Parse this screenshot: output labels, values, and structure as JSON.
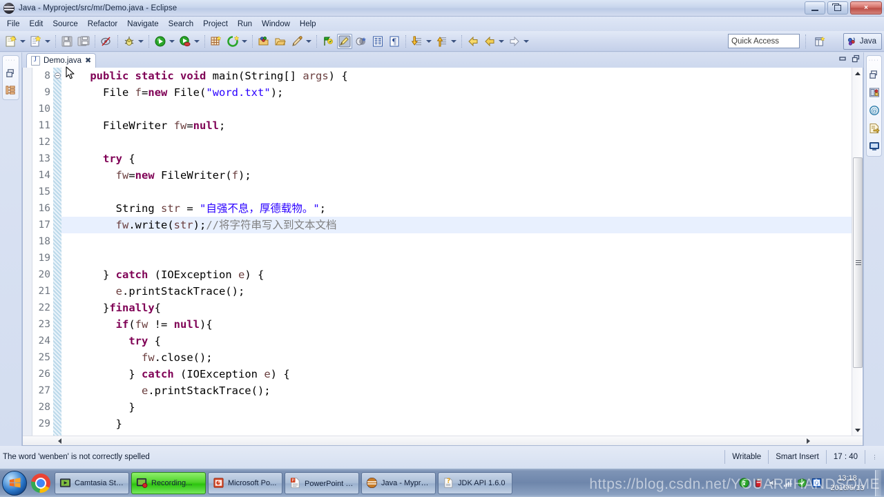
{
  "window": {
    "title": "Java - Myproject/src/mr/Demo.java - Eclipse",
    "icon": "eclipse-icon",
    "minimize_label": "Minimize",
    "maximize_label": "Restore",
    "close_label": "×"
  },
  "menubar": {
    "items": [
      {
        "label": "File"
      },
      {
        "label": "Edit"
      },
      {
        "label": "Source"
      },
      {
        "label": "Refactor"
      },
      {
        "label": "Navigate"
      },
      {
        "label": "Search"
      },
      {
        "label": "Project"
      },
      {
        "label": "Run"
      },
      {
        "label": "Window"
      },
      {
        "label": "Help"
      }
    ]
  },
  "toolbar": {
    "quick_access_placeholder": "Quick Access",
    "perspective_label": "Java",
    "open_perspective_icon": "open-perspective-icon",
    "buttons": [
      {
        "name": "new-wizard-icon",
        "has_dropdown": true
      },
      {
        "name": "new-java-class-icon",
        "has_dropdown": true
      },
      {
        "name": "save-icon",
        "has_dropdown": false
      },
      {
        "name": "save-all-icon",
        "has_dropdown": false
      },
      {
        "name": "toggle-breakpoint-skip-icon",
        "has_dropdown": false
      },
      {
        "name": "debug-icon",
        "has_dropdown": true
      },
      {
        "name": "run-icon",
        "has_dropdown": true
      },
      {
        "name": "run-coverage-icon",
        "has_dropdown": true
      },
      {
        "name": "new-java-project-icon",
        "has_dropdown": false
      },
      {
        "name": "external-tools-icon",
        "has_dropdown": true
      },
      {
        "name": "open-type-icon",
        "has_dropdown": false
      },
      {
        "name": "open-task-icon",
        "has_dropdown": false
      },
      {
        "name": "search-pencil-icon",
        "has_dropdown": true
      },
      {
        "name": "last-edit-location-icon",
        "has_dropdown": false
      },
      {
        "name": "toggle-mark-occurrences-icon",
        "has_dropdown": false,
        "pressed": true
      },
      {
        "name": "link-with-editor-icon",
        "has_dropdown": false
      },
      {
        "name": "show-whitespace-icon",
        "has_dropdown": false
      },
      {
        "name": "pilcrow-icon",
        "has_dropdown": false
      },
      {
        "name": "next-annotation-icon",
        "has_dropdown": true
      },
      {
        "name": "previous-annotation-icon",
        "has_dropdown": true
      },
      {
        "name": "back-icon",
        "has_dropdown": false
      },
      {
        "name": "forward-icon",
        "has_dropdown": true
      }
    ]
  },
  "left_rail": {
    "items": [
      {
        "name": "restore-view-icon",
        "label": "Restore"
      },
      {
        "name": "package-explorer-icon",
        "label": "Package Explorer"
      }
    ]
  },
  "right_rail": {
    "items": [
      {
        "name": "restore-view-icon",
        "label": "Restore"
      },
      {
        "name": "outline-view-icon",
        "label": "Outline"
      },
      {
        "name": "javadoc-view-icon",
        "label": "Javadoc"
      },
      {
        "name": "declaration-view-icon",
        "label": "Declaration"
      },
      {
        "name": "console-view-icon",
        "label": "Console"
      }
    ]
  },
  "editor": {
    "tab": {
      "label": "Demo.java",
      "icon": "java-file-icon",
      "close": "✖"
    },
    "minimize_label": "Minimize",
    "maximize_label": "Maximize",
    "highlighted_line": 17,
    "first_visible_line": 8,
    "lines": [
      {
        "n": 8,
        "folding": true,
        "indent": 4,
        "tokens": [
          {
            "t": "public ",
            "c": "kw"
          },
          {
            "t": "static ",
            "c": "kw"
          },
          {
            "t": "void ",
            "c": "kw"
          },
          {
            "t": "main",
            "c": "mth"
          },
          {
            "t": "(",
            "c": "typ"
          },
          {
            "t": "String",
            "c": "typ"
          },
          {
            "t": "[] ",
            "c": "typ"
          },
          {
            "t": "args",
            "c": "loc"
          },
          {
            "t": ") {",
            "c": "typ"
          }
        ]
      },
      {
        "n": 9,
        "folding": false,
        "indent": 6,
        "tokens": [
          {
            "t": "File ",
            "c": "typ"
          },
          {
            "t": "f",
            "c": "loc"
          },
          {
            "t": "=",
            "c": "typ"
          },
          {
            "t": "new ",
            "c": "kw"
          },
          {
            "t": "File(",
            "c": "typ"
          },
          {
            "t": "\"word.txt\"",
            "c": "str"
          },
          {
            "t": ");",
            "c": "typ"
          }
        ]
      },
      {
        "n": 10,
        "folding": false,
        "indent": 0,
        "tokens": []
      },
      {
        "n": 11,
        "folding": false,
        "indent": 6,
        "tokens": [
          {
            "t": "FileWriter ",
            "c": "typ"
          },
          {
            "t": "fw",
            "c": "loc"
          },
          {
            "t": "=",
            "c": "typ"
          },
          {
            "t": "null",
            "c": "kw"
          },
          {
            "t": ";",
            "c": "typ"
          }
        ]
      },
      {
        "n": 12,
        "folding": false,
        "indent": 0,
        "tokens": []
      },
      {
        "n": 13,
        "folding": false,
        "indent": 6,
        "tokens": [
          {
            "t": "try",
            "c": "kw"
          },
          {
            "t": " {",
            "c": "typ"
          }
        ]
      },
      {
        "n": 14,
        "folding": false,
        "indent": 8,
        "tokens": [
          {
            "t": "fw",
            "c": "loc"
          },
          {
            "t": "=",
            "c": "typ"
          },
          {
            "t": "new ",
            "c": "kw"
          },
          {
            "t": "FileWriter(",
            "c": "typ"
          },
          {
            "t": "f",
            "c": "loc"
          },
          {
            "t": ");",
            "c": "typ"
          }
        ]
      },
      {
        "n": 15,
        "folding": false,
        "indent": 0,
        "tokens": []
      },
      {
        "n": 16,
        "folding": false,
        "indent": 8,
        "tokens": [
          {
            "t": "String ",
            "c": "typ"
          },
          {
            "t": "str",
            "c": "loc"
          },
          {
            "t": " = ",
            "c": "typ"
          },
          {
            "t": "\"自强不息，厚德载物。\"",
            "c": "str"
          },
          {
            "t": ";",
            "c": "typ"
          }
        ]
      },
      {
        "n": 17,
        "folding": false,
        "indent": 8,
        "tokens": [
          {
            "t": "fw",
            "c": "loc"
          },
          {
            "t": ".write(",
            "c": "typ"
          },
          {
            "t": "str",
            "c": "loc"
          },
          {
            "t": ");",
            "c": "typ"
          },
          {
            "t": "//将字符串写入到文本文档",
            "c": "cmt-zh"
          }
        ]
      },
      {
        "n": 18,
        "folding": false,
        "indent": 0,
        "tokens": []
      },
      {
        "n": 19,
        "folding": false,
        "indent": 0,
        "tokens": []
      },
      {
        "n": 20,
        "folding": false,
        "indent": 6,
        "tokens": [
          {
            "t": "} ",
            "c": "typ"
          },
          {
            "t": "catch",
            "c": "kw"
          },
          {
            "t": " (IOException ",
            "c": "typ"
          },
          {
            "t": "e",
            "c": "loc"
          },
          {
            "t": ") {",
            "c": "typ"
          }
        ]
      },
      {
        "n": 21,
        "folding": false,
        "indent": 8,
        "tokens": [
          {
            "t": "e",
            "c": "loc"
          },
          {
            "t": ".printStackTrace();",
            "c": "typ"
          }
        ]
      },
      {
        "n": 22,
        "folding": false,
        "indent": 6,
        "tokens": [
          {
            "t": "}",
            "c": "typ"
          },
          {
            "t": "finally",
            "c": "kw"
          },
          {
            "t": "{",
            "c": "typ"
          }
        ]
      },
      {
        "n": 23,
        "folding": false,
        "indent": 8,
        "tokens": [
          {
            "t": "if",
            "c": "kw"
          },
          {
            "t": "(",
            "c": "typ"
          },
          {
            "t": "fw ",
            "c": "loc"
          },
          {
            "t": "!= ",
            "c": "typ"
          },
          {
            "t": "null",
            "c": "kw"
          },
          {
            "t": "){",
            "c": "typ"
          }
        ]
      },
      {
        "n": 24,
        "folding": false,
        "indent": 10,
        "tokens": [
          {
            "t": "try",
            "c": "kw"
          },
          {
            "t": " {",
            "c": "typ"
          }
        ]
      },
      {
        "n": 25,
        "folding": false,
        "indent": 12,
        "tokens": [
          {
            "t": "fw",
            "c": "loc"
          },
          {
            "t": ".close();",
            "c": "typ"
          }
        ]
      },
      {
        "n": 26,
        "folding": false,
        "indent": 10,
        "tokens": [
          {
            "t": "} ",
            "c": "typ"
          },
          {
            "t": "catch",
            "c": "kw"
          },
          {
            "t": " (IOException ",
            "c": "typ"
          },
          {
            "t": "e",
            "c": "loc"
          },
          {
            "t": ") {",
            "c": "typ"
          }
        ]
      },
      {
        "n": 27,
        "folding": false,
        "indent": 12,
        "tokens": [
          {
            "t": "e",
            "c": "loc"
          },
          {
            "t": ".printStackTrace();",
            "c": "typ"
          }
        ]
      },
      {
        "n": 28,
        "folding": false,
        "indent": 10,
        "tokens": [
          {
            "t": "}",
            "c": "typ"
          }
        ]
      },
      {
        "n": 29,
        "folding": false,
        "indent": 8,
        "tokens": [
          {
            "t": "}",
            "c": "typ"
          }
        ]
      }
    ]
  },
  "statusbar": {
    "message": "The word 'wenben' is not correctly spelled",
    "writable": "Writable",
    "insert_mode": "Smart Insert",
    "position": "17 : 40"
  },
  "taskbar": {
    "start_label": "Start",
    "chrome_label": "Google Chrome",
    "items": [
      {
        "label": "Camtasia Stu...",
        "icon": "camtasia-icon",
        "active": false
      },
      {
        "label": "Recording...",
        "icon": "camtasia-recording-icon",
        "active": true
      },
      {
        "label": "Microsoft Po...",
        "icon": "powerpoint-icon",
        "active": false
      },
      {
        "label": "PowerPoint 幻...",
        "icon": "powerpoint-doc-icon",
        "active": false
      },
      {
        "label": "Java - Myproj...",
        "icon": "eclipse-icon",
        "active": false
      },
      {
        "label": "JDK API 1.6.0",
        "icon": "chm-help-icon",
        "active": false
      }
    ],
    "tray": [
      {
        "name": "sogou-input-icon"
      },
      {
        "name": "antivirus-icon"
      },
      {
        "name": "volume-icon"
      },
      {
        "name": "network-signal-icon"
      },
      {
        "name": "360-shield-icon"
      },
      {
        "name": "qq-icon"
      }
    ],
    "clock_time": "13:18",
    "clock_date": "2016/5/13"
  },
  "watermark": {
    "text": "https://blog.csdn.net/YOUARFHANDSOME"
  },
  "colors": {
    "keyword": "#7f0055",
    "string": "#2a00ff",
    "comment": "#808080",
    "local_var": "#6a3e3e",
    "highlight_line": "#e8f0fe",
    "accent": "#2a76c8"
  }
}
